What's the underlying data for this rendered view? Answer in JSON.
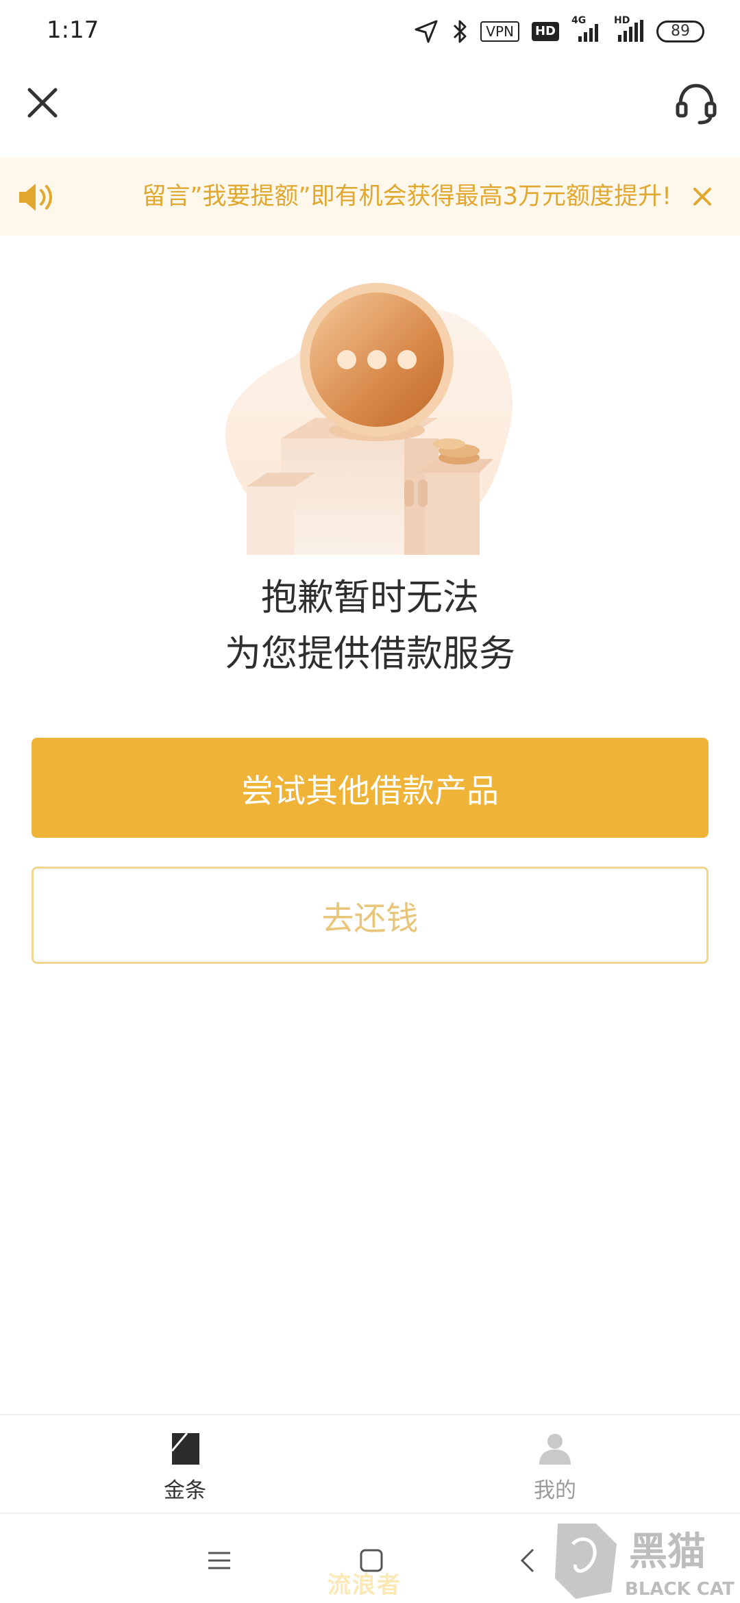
{
  "status_bar": {
    "time": "1:17",
    "vpn_label": "VPN",
    "hd_label": "HD",
    "network_label": "4G",
    "hd2_label": "HD",
    "battery": "89"
  },
  "notice": {
    "text": "留言”我要提额”即有机会获得最高3万元额度提升!"
  },
  "message": {
    "line1": "抱歉暂时无法",
    "line2": "为您提供借款服务"
  },
  "buttons": {
    "primary": "尝试其他借款产品",
    "secondary": "去还钱"
  },
  "tabs": [
    {
      "label": "金条",
      "active": true
    },
    {
      "label": "我的",
      "active": false
    }
  ],
  "watermark": {
    "brand_cn": "黑猫",
    "brand_en": "BLACK CAT",
    "author": "流浪者"
  },
  "colors": {
    "accent": "#eeb337",
    "notice_text": "#e1a72e",
    "notice_bg": "#fdf7ec"
  }
}
